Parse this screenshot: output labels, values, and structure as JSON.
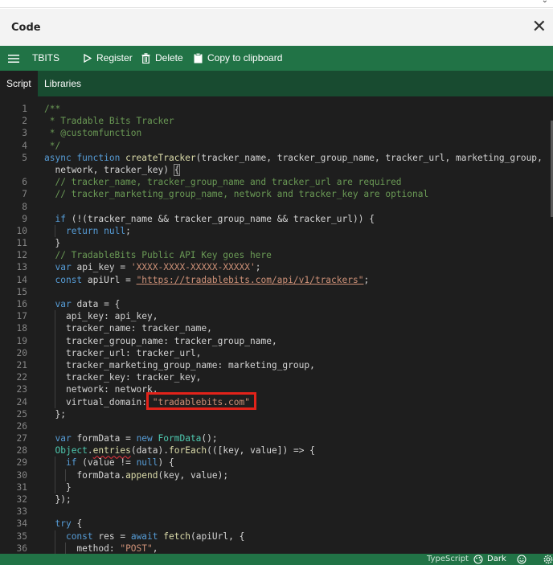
{
  "window": {
    "title": "Code"
  },
  "toolbar": {
    "app_name": "TBITS",
    "register_label": "Register",
    "delete_label": "Delete",
    "copy_label": "Copy to clipboard"
  },
  "tabs": [
    {
      "label": "Script"
    },
    {
      "label": "Libraries"
    }
  ],
  "status": {
    "language": "TypeScript",
    "theme": "Dark"
  },
  "highlight": {
    "color": "#e2231a",
    "text": "\"tradablebits.com\""
  },
  "code": {
    "line_numbers": [
      "1",
      "2",
      "3",
      "4",
      "5",
      "",
      "6",
      "7",
      "8",
      "9",
      "10",
      "11",
      "12",
      "13",
      "14",
      "15",
      "16",
      "17",
      "18",
      "19",
      "20",
      "21",
      "22",
      "23",
      "24",
      "25",
      "26",
      "27",
      "28",
      "29",
      "30",
      "31",
      "32",
      "33",
      "34",
      "35",
      "36"
    ],
    "lines": [
      "/**",
      " * Tradable Bits Tracker",
      " * @customfunction",
      " */",
      "async function createTracker(tracker_name, tracker_group_name, tracker_url, marketing_group,",
      "  network, tracker_key) {",
      "  // tracker_name, tracker_group_name and tracker_url are required",
      "  // tracker_marketing_group_name, network and tracker_key are optional",
      "",
      "  if (!(tracker_name && tracker_group_name && tracker_url)) {",
      "    return null;",
      "  }",
      "  // TradableBits Public API Key goes here",
      "  var api_key = 'XXXX-XXXX-XXXXX-XXXXX';",
      "  const apiUrl = \"https://tradablebits.com/api/v1/trackers\";",
      "",
      "  var data = {",
      "    api_key: api_key,",
      "    tracker_name: tracker_name,",
      "    tracker_group_name: tracker_group_name,",
      "    tracker_url: tracker_url,",
      "    tracker_marketing_group_name: marketing_group,",
      "    tracker_key: tracker_key,",
      "    network: network,",
      "    virtual_domain: \"tradablebits.com\"",
      "  };",
      "",
      "  var formData = new FormData();",
      "  Object.entries(data).forEach(([key, value]) => {",
      "    if (value != null) {",
      "      formData.append(key, value);",
      "    }",
      "  });",
      "",
      "  try {",
      "    const res = await fetch(apiUrl, {",
      "      method: \"POST\","
    ]
  }
}
